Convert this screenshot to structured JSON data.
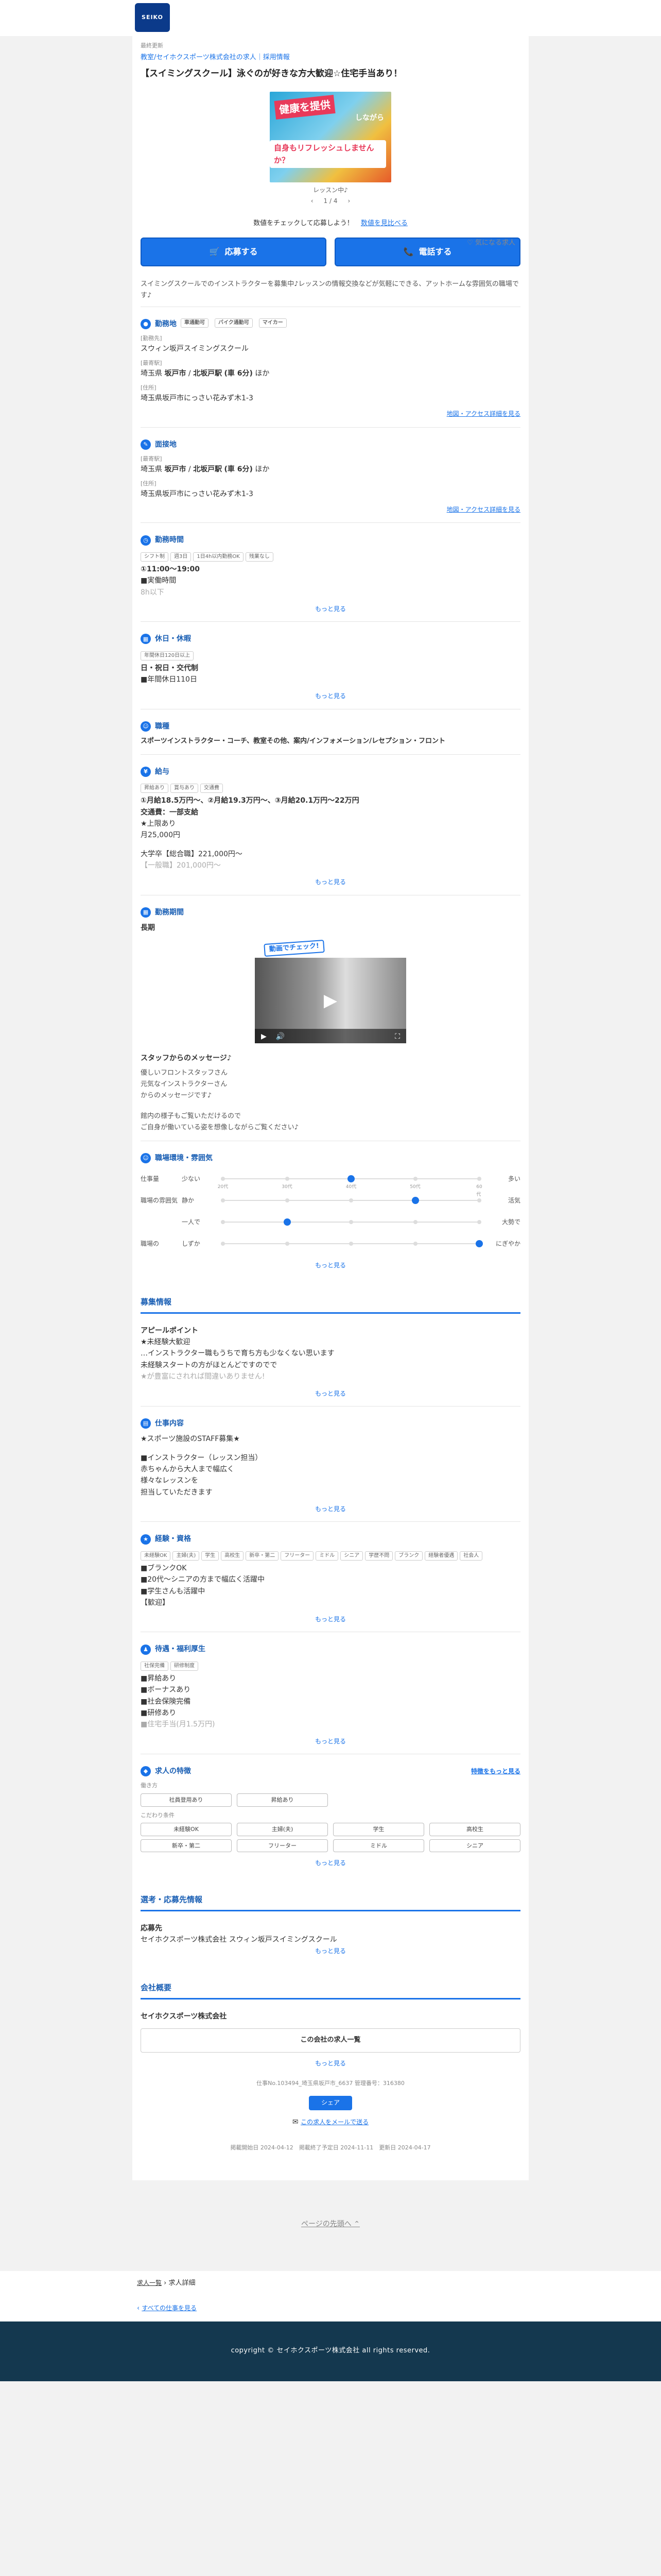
{
  "header": {
    "logo_text": "SEIKO"
  },
  "job": {
    "label_top": "最終更新",
    "breadcrumb": "教室/セイホクスポーツ株式会社の求人｜採用情報",
    "title": "【スイミングスクール】泳ぐのが好きな方大歓迎☆住宅手当あり！",
    "hero_text1": "健康を提供",
    "hero_text2": "しながら",
    "hero_text3": "自身もリフレッシュしませんか？",
    "slide_caption": "レッスン中♪",
    "slide_prev": "‹",
    "slide_count": "1 / 4",
    "slide_next": "›",
    "favorite": "♡ 気になる求人",
    "check_text": "数値をチェックして応募しよう！",
    "check_link": "数値を見比べる",
    "apply_btn": "応募する",
    "call_btn": "電話する",
    "intro": "スイミングスクールでのインストラクターを募集中♪レッスンの情報交換などが気軽にできる、アットホームな雰囲気の職場です♪"
  },
  "location": {
    "heading": "勤務地",
    "tags": [
      "車通勤可",
      "バイク通勤可",
      "マイカー"
    ],
    "name_lbl": "[勤務先]",
    "name": "スウィン坂戸スイミングスクール",
    "station_lbl": "[最寄駅]",
    "station_pref": "埼玉県",
    "station_city": "坂戸市",
    "station_sep": "/",
    "station_name": "北坂戸駅",
    "station_walk": "(車 6分)",
    "station_more": "ほか",
    "addr_lbl": "[住所]",
    "addr": "埼玉県坂戸市にっさい花みず木1-3",
    "map_link": "地図・アクセス詳細を見る"
  },
  "interview": {
    "heading": "面接地",
    "station_lbl": "[最寄駅]",
    "station_pref": "埼玉県",
    "station_city": "坂戸市",
    "station_sep": "/",
    "station_name": "北坂戸駅",
    "station_walk": "(車 6分)",
    "station_more": "ほか",
    "addr_lbl": "[住所]",
    "addr": "埼玉県坂戸市にっさい花みず木1-3",
    "map_link": "地図・アクセス詳細を見る"
  },
  "hours": {
    "heading": "勤務時間",
    "tags": [
      "シフト制",
      "週3日",
      "1日4h以内勤務OK",
      "残業なし"
    ],
    "time": "①11:00～19:00",
    "note": "■実働時間",
    "fade": "8h以下",
    "more": "もっと見る"
  },
  "holiday": {
    "heading": "休日・休暇",
    "tags": [
      "年間休日120日以上"
    ],
    "text": "日・祝日・交代制",
    "note": "■年間休日110日",
    "more": "もっと見る"
  },
  "job_type": {
    "heading": "職種",
    "text": "スポーツインストラクター・コーチ、教室その他、案内/インフォメーション/レセプション・フロント"
  },
  "salary": {
    "heading": "給与",
    "tags": [
      "昇給あり",
      "賞与あり",
      "交通費"
    ],
    "text": "①月給18.5万円～、②月給19.3万円～、③月給20.1万円～22万円",
    "transport": "交通費：一部支給",
    "note1": "★上限あり",
    "note2": "月25,000円",
    "note3": "大学卒【総合職】221,000円～",
    "note4": "【一般職】201,000円～",
    "more": "もっと見る"
  },
  "period": {
    "heading": "勤務期間",
    "text": "長期"
  },
  "video": {
    "badge": "動画でチェック!",
    "play": "▶",
    "ctrl_play": "▶",
    "ctrl_vol": "🔊",
    "ctrl_full": "⛶"
  },
  "staff_msg": {
    "heading": "スタッフからのメッセージ♪",
    "lines": [
      "優しいフロントスタッフさん",
      "元気なインストラクターさん",
      "からのメッセージです♪",
      "",
      "館内の様子もご覧いただけるので",
      "ご自身が働いている姿を想像しながらご覧ください♪"
    ]
  },
  "env": {
    "heading": "職場環境・雰囲気",
    "rows": [
      {
        "left_lbl": "仕事量",
        "left": "少ない",
        "right": "多い",
        "level": 0.5
      },
      {
        "left_lbl": "職場の雰囲気",
        "left": "静か",
        "right": "活気",
        "level": 0.75
      },
      {
        "left_lbl": "",
        "left": "一人で",
        "right": "大勢で",
        "level": 0.25
      },
      {
        "left_lbl": "職場の",
        "left": "しずか",
        "right": "にぎやか",
        "level": 1.0
      }
    ],
    "tick_labels": [
      "20代",
      "30代",
      "40代",
      "50代",
      "60代"
    ],
    "more": "もっと見る"
  },
  "recruit": {
    "heading": "募集情報",
    "appeal_heading": "アピールポイント",
    "appeal_lines": [
      "★未経験大歓迎",
      "…インストラクター職もうちで育ち方も少なくない思います",
      "未経験スタートの方がほとんどですのでで",
      "★が豊富にされれば間違いありません!"
    ],
    "more1": "もっと見る",
    "work_heading": "仕事内容",
    "work_lines": [
      "★スポーツ施設のSTAFF募集★",
      "",
      "■インストラクター（レッスン担当）",
      "赤ちゃんから大人まで幅広く",
      "様々なレッスンを",
      "担当していただきます"
    ],
    "more2": "もっと見る",
    "qual_heading": "経験・資格",
    "qual_tags": [
      "未経験OK",
      "主婦(夫)",
      "学生",
      "高校生",
      "新卒・第二",
      "フリーター",
      "ミドル",
      "シニア",
      "学歴不問",
      "ブランク",
      "経験者優遇",
      "社会人"
    ],
    "qual_lines": [
      "■ブランクOK",
      "■20代〜シニアの方まで幅広く活躍中",
      "■学生さんも活躍中",
      "【歓迎】"
    ],
    "more3": "もっと見る",
    "welfare_heading": "待遇・福利厚生",
    "welfare_tags": [
      "社保完備",
      "研修制度"
    ],
    "welfare_lines": [
      "■昇給あり",
      "■ボーナスあり",
      "■社会保険完備",
      "■研修あり",
      "■住宅手当(月1.5万円)"
    ],
    "more4": "もっと見る",
    "feature_heading": "求人の特徴",
    "feature_link": "特徴をもっと見る",
    "feature_group1": "働き方",
    "feature_group1_items": [
      "社員登用あり",
      "昇給あり"
    ],
    "feature_group2": "こだわり条件",
    "feature_items": [
      "未経験OK",
      "主婦(夫)",
      "学生",
      "高校生",
      "新卒・第二",
      "フリーター",
      "ミドル",
      "シニア"
    ],
    "more5": "もっと見る"
  },
  "apply": {
    "heading": "選考・応募先情報",
    "sub": "応募先",
    "text": "セイホクスポーツ株式会社 スウィン坂戸スイミングスクール",
    "more": "もっと見る"
  },
  "company": {
    "heading": "会社概要",
    "name": "セイホクスポーツ株式会社",
    "btn": "この会社の求人一覧",
    "more": "もっと見る",
    "ids": "仕事No.103494_埼玉県坂戸市_6637 管理番号：316380",
    "share": "シェア",
    "mail_link": "この求人をメールで送る",
    "dates": "掲載開始日 2024-04-12　掲載終了予定日 2024-11-11　更新日 2024-04-17"
  },
  "footer": {
    "top": "ページの先頭へ ⌃",
    "bread1": "求人一覧",
    "bread1b": "求人詳細",
    "bread2": "すべての仕事を見る",
    "copyright": "copyright © セイホクスポーツ株式会社 all rights reserved."
  }
}
